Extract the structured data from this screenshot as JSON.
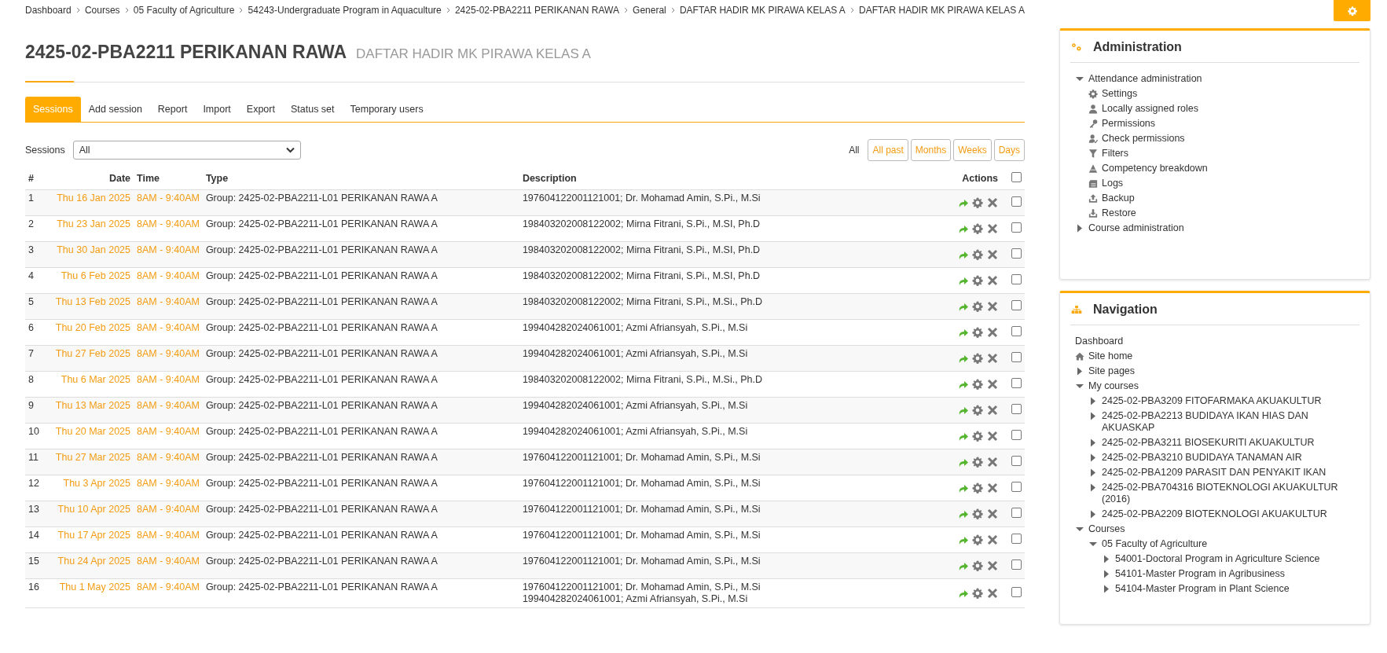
{
  "breadcrumb": [
    "Dashboard",
    "Courses",
    "05 Faculty of Agriculture",
    "54243-Undergraduate Program in Aquaculture",
    "2425-02-PBA2211 PERIKANAN RAWA",
    "General",
    "DAFTAR HADIR MK PIRAWA KELAS A",
    "DAFTAR HADIR MK PIRAWA KELAS A"
  ],
  "heading": {
    "title": "2425-02-PBA2211 PERIKANAN RAWA",
    "subtitle": "DAFTAR HADIR MK PIRAWA KELAS A"
  },
  "tabs": [
    {
      "label": "Sessions",
      "selected": true
    },
    {
      "label": "Add session",
      "selected": false
    },
    {
      "label": "Report",
      "selected": false
    },
    {
      "label": "Import",
      "selected": false
    },
    {
      "label": "Export",
      "selected": false
    },
    {
      "label": "Status set",
      "selected": false
    },
    {
      "label": "Temporary users",
      "selected": false
    }
  ],
  "sessions_filter": {
    "label": "Sessions",
    "value": "All"
  },
  "period_filters": [
    {
      "label": "All",
      "selected": true
    },
    {
      "label": "All past",
      "selected": false
    },
    {
      "label": "Months",
      "selected": false
    },
    {
      "label": "Weeks",
      "selected": false
    },
    {
      "label": "Days",
      "selected": false
    }
  ],
  "table": {
    "columns": [
      "#",
      "Date",
      "Time",
      "Type",
      "Description",
      "Actions"
    ],
    "select_all_checked": false,
    "rows": [
      {
        "n": "1",
        "date": "Thu 16 Jan 2025",
        "time": "8AM - 9:40AM",
        "type": "Group: 2425-02-PBA2211-L01 PERIKANAN RAWA A",
        "description": [
          "197604122001121001; Dr. Mohamad Amin, S.Pi., M.Si"
        ],
        "checked": false
      },
      {
        "n": "2",
        "date": "Thu 23 Jan 2025",
        "time": "8AM - 9:40AM",
        "type": "Group: 2425-02-PBA2211-L01 PERIKANAN RAWA A",
        "description": [
          "198403202008122002; Mirna Fitrani, S.Pi., M.SI, Ph.D"
        ],
        "checked": false
      },
      {
        "n": "3",
        "date": "Thu 30 Jan 2025",
        "time": "8AM - 9:40AM",
        "type": "Group: 2425-02-PBA2211-L01 PERIKANAN RAWA A",
        "description": [
          "198403202008122002; Mirna Fitrani, S.Pi., M.SI, Ph.D"
        ],
        "checked": false
      },
      {
        "n": "4",
        "date": "Thu 6 Feb 2025",
        "time": "8AM - 9:40AM",
        "type": "Group: 2425-02-PBA2211-L01 PERIKANAN RAWA A",
        "description": [
          "198403202008122002; Mirna Fitrani, S.Pi., M.SI, Ph.D"
        ],
        "checked": false
      },
      {
        "n": "5",
        "date": "Thu 13 Feb 2025",
        "time": "8AM - 9:40AM",
        "type": "Group: 2425-02-PBA2211-L01 PERIKANAN RAWA A",
        "description": [
          "198403202008122002; Mirna Fitrani, S.Pi., M.Si., Ph.D"
        ],
        "checked": false
      },
      {
        "n": "6",
        "date": "Thu 20 Feb 2025",
        "time": "8AM - 9:40AM",
        "type": "Group: 2425-02-PBA2211-L01 PERIKANAN RAWA A",
        "description": [
          "199404282024061001; Azmi Afriansyah, S.Pi., M.Si"
        ],
        "checked": false
      },
      {
        "n": "7",
        "date": "Thu 27 Feb 2025",
        "time": "8AM - 9:40AM",
        "type": "Group: 2425-02-PBA2211-L01 PERIKANAN RAWA A",
        "description": [
          "199404282024061001; Azmi Afriansyah, S.Pi., M.Si"
        ],
        "checked": false
      },
      {
        "n": "8",
        "date": "Thu 6 Mar 2025",
        "time": "8AM - 9:40AM",
        "type": "Group: 2425-02-PBA2211-L01 PERIKANAN RAWA A",
        "description": [
          "198403202008122002; Mirna Fitrani, S.Pi., M.Si., Ph.D"
        ],
        "checked": false
      },
      {
        "n": "9",
        "date": "Thu 13 Mar 2025",
        "time": "8AM - 9:40AM",
        "type": "Group: 2425-02-PBA2211-L01 PERIKANAN RAWA A",
        "description": [
          "199404282024061001; Azmi Afriansyah, S.Pi., M.Si"
        ],
        "checked": false
      },
      {
        "n": "10",
        "date": "Thu 20 Mar 2025",
        "time": "8AM - 9:40AM",
        "type": "Group: 2425-02-PBA2211-L01 PERIKANAN RAWA A",
        "description": [
          "199404282024061001; Azmi Afriansyah, S.Pi., M.Si"
        ],
        "checked": false
      },
      {
        "n": "11",
        "date": "Thu 27 Mar 2025",
        "time": "8AM - 9:40AM",
        "type": "Group: 2425-02-PBA2211-L01 PERIKANAN RAWA A",
        "description": [
          "197604122001121001; Dr. Mohamad Amin, S.Pi., M.Si"
        ],
        "checked": false
      },
      {
        "n": "12",
        "date": "Thu 3 Apr 2025",
        "time": "8AM - 9:40AM",
        "type": "Group: 2425-02-PBA2211-L01 PERIKANAN RAWA A",
        "description": [
          "197604122001121001; Dr. Mohamad Amin, S.Pi., M.Si"
        ],
        "checked": false
      },
      {
        "n": "13",
        "date": "Thu 10 Apr 2025",
        "time": "8AM - 9:40AM",
        "type": "Group: 2425-02-PBA2211-L01 PERIKANAN RAWA A",
        "description": [
          "197604122001121001; Dr. Mohamad Amin, S.Pi., M.Si"
        ],
        "checked": false
      },
      {
        "n": "14",
        "date": "Thu 17 Apr 2025",
        "time": "8AM - 9:40AM",
        "type": "Group: 2425-02-PBA2211-L01 PERIKANAN RAWA A",
        "description": [
          "197604122001121001; Dr. Mohamad Amin, S.Pi., M.Si"
        ],
        "checked": false
      },
      {
        "n": "15",
        "date": "Thu 24 Apr 2025",
        "time": "8AM - 9:40AM",
        "type": "Group: 2425-02-PBA2211-L01 PERIKANAN RAWA A",
        "description": [
          "197604122001121001; Dr. Mohamad Amin, S.Pi., M.Si"
        ],
        "checked": false
      },
      {
        "n": "16",
        "date": "Thu 1 May 2025",
        "time": "8AM - 9:40AM",
        "type": "Group: 2425-02-PBA2211-L01 PERIKANAN RAWA A",
        "description": [
          "197604122001121001; Dr. Mohamad Amin, S.Pi., M.Si",
          "199404282024061001; Azmi Afriansyah, S.Pi., M.Si"
        ],
        "checked": false
      }
    ]
  },
  "administration": {
    "title": "Administration",
    "items": [
      {
        "label": "Attendance administration",
        "kind": "branch",
        "expanded": true,
        "children": [
          {
            "label": "Settings",
            "kind": "leaf"
          },
          {
            "label": "Locally assigned roles",
            "kind": "leaf"
          },
          {
            "label": "Permissions",
            "kind": "leaf"
          },
          {
            "label": "Check permissions",
            "kind": "leaf"
          },
          {
            "label": "Filters",
            "kind": "leaf"
          },
          {
            "label": "Competency breakdown",
            "kind": "leaf"
          },
          {
            "label": "Logs",
            "kind": "leaf"
          },
          {
            "label": "Backup",
            "kind": "leaf"
          },
          {
            "label": "Restore",
            "kind": "leaf"
          }
        ]
      },
      {
        "label": "Course administration",
        "kind": "branch",
        "expanded": false
      }
    ]
  },
  "navigation": {
    "title": "Navigation",
    "items": [
      {
        "label": "Dashboard",
        "kind": "plain"
      },
      {
        "label": "Site home",
        "kind": "home"
      },
      {
        "label": "Site pages",
        "kind": "branch",
        "expanded": false
      },
      {
        "label": "My courses",
        "kind": "branch",
        "expanded": true,
        "children": [
          {
            "label": "2425-02-PBA3209 FITOFARMAKA AKUAKULTUR",
            "kind": "branch",
            "expanded": false
          },
          {
            "label": "2425-02-PBA2213 BUDIDAYA IKAN HIAS DAN AKUASKAP",
            "kind": "branch",
            "expanded": false
          },
          {
            "label": "2425-02-PBA3211 BIOSEKURITI AKUAKULTUR",
            "kind": "branch",
            "expanded": false
          },
          {
            "label": "2425-02-PBA3210 BUDIDAYA TANAMAN AIR",
            "kind": "branch",
            "expanded": false
          },
          {
            "label": "2425-02-PBA1209 PARASIT DAN PENYAKIT IKAN",
            "kind": "branch",
            "expanded": false
          },
          {
            "label": "2425-02-PBA704316 BIOTEKNOLOGI AKUAKULTUR (2016)",
            "kind": "branch",
            "expanded": false
          },
          {
            "label": "2425-02-PBA2209 BIOTEKNOLOGI AKUAKULTUR",
            "kind": "branch",
            "expanded": false
          }
        ]
      },
      {
        "label": "Courses",
        "kind": "branch",
        "expanded": true,
        "children": [
          {
            "label": "05 Faculty of Agriculture",
            "kind": "branch",
            "expanded": true,
            "children": [
              {
                "label": "54001-Doctoral Program in Agriculture Science",
                "kind": "branch",
                "expanded": false
              },
              {
                "label": "54101-Master Program in Agribusiness",
                "kind": "branch",
                "expanded": false
              },
              {
                "label": "54104-Master Program in Plant Science",
                "kind": "branch",
                "expanded": false
              }
            ]
          }
        ]
      }
    ]
  }
}
